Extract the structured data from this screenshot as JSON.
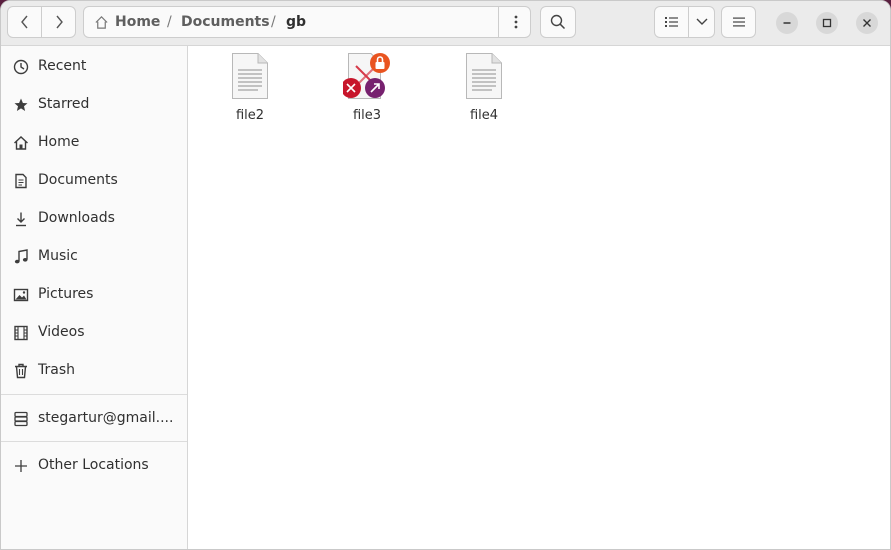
{
  "header": {
    "breadcrumb": [
      "Home",
      "Documents",
      "gb"
    ],
    "separator": "/"
  },
  "sidebar": {
    "items": [
      {
        "label": "Recent",
        "icon": "clock-icon"
      },
      {
        "label": "Starred",
        "icon": "star-icon"
      },
      {
        "label": "Home",
        "icon": "home-icon"
      },
      {
        "label": "Documents",
        "icon": "document-icon"
      },
      {
        "label": "Downloads",
        "icon": "download-icon"
      },
      {
        "label": "Music",
        "icon": "music-icon"
      },
      {
        "label": "Pictures",
        "icon": "picture-icon"
      },
      {
        "label": "Videos",
        "icon": "video-icon"
      },
      {
        "label": "Trash",
        "icon": "trash-icon"
      }
    ],
    "account": {
      "label": "stegartur@gmail....",
      "icon": "network-drive-icon"
    },
    "other": {
      "label": "Other Locations",
      "icon": "plus-icon"
    }
  },
  "files": [
    {
      "name": "file2",
      "icon": "text-file-icon"
    },
    {
      "name": "file3",
      "icon": "broken-link-locked-icon"
    },
    {
      "name": "file4",
      "icon": "text-file-icon"
    }
  ],
  "colors": {
    "emblem_lock": "#e95420",
    "emblem_broken": "#c7162b",
    "emblem_link": "#77216f",
    "desktop_bg": "#5a1f3f"
  }
}
